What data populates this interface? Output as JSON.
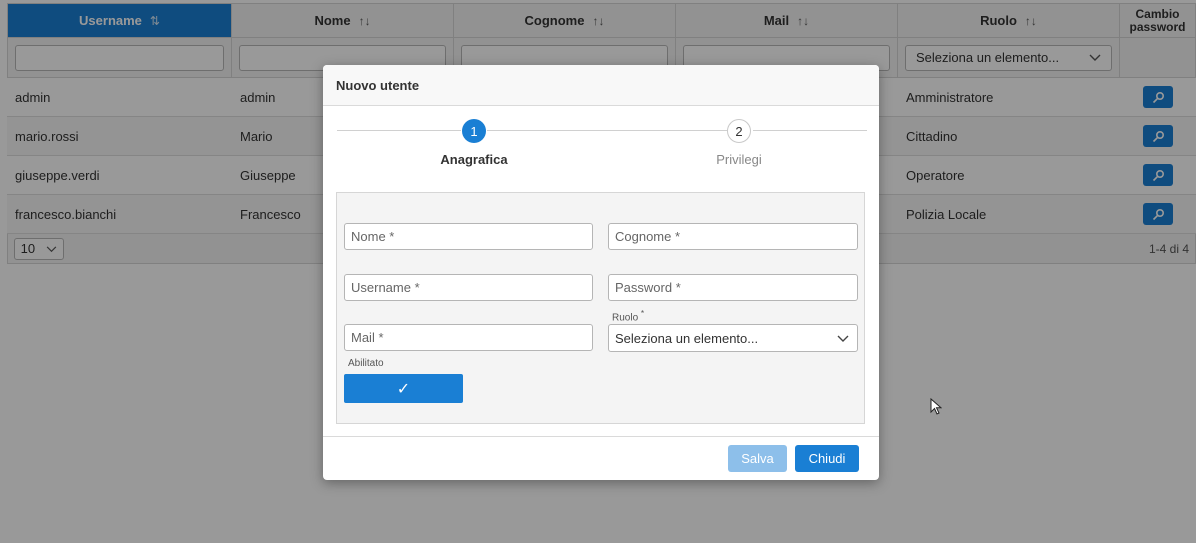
{
  "table": {
    "columns": [
      {
        "label": "Username",
        "sort": "⇅",
        "active": true
      },
      {
        "label": "Nome",
        "sort": "↑↓"
      },
      {
        "label": "Cognome",
        "sort": "↑↓"
      },
      {
        "label": "Mail",
        "sort": "↑↓"
      },
      {
        "label": "Ruolo",
        "sort": "↑↓"
      },
      {
        "label": "Cambio password"
      }
    ],
    "role_filter_placeholder": "Seleziona un elemento...",
    "rows": [
      {
        "username": "admin",
        "nome": "admin",
        "ruolo": "Amministratore"
      },
      {
        "username": "mario.rossi",
        "nome": "Mario",
        "ruolo": "Cittadino"
      },
      {
        "username": "giuseppe.verdi",
        "nome": "Giuseppe",
        "ruolo": "Operatore"
      },
      {
        "username": "francesco.bianchi",
        "nome": "Francesco",
        "ruolo": "Polizia Locale"
      }
    ],
    "page_size": "10",
    "count_label": "1-4 di 4"
  },
  "modal": {
    "title": "Nuovo utente",
    "steps": [
      {
        "number": "1",
        "label": "Anagrafica",
        "active": true
      },
      {
        "number": "2",
        "label": "Privilegi",
        "active": false
      }
    ],
    "fields": {
      "nome": "Nome *",
      "cognome": "Cognome *",
      "username": "Username *",
      "password": "Password *",
      "mail": "Mail *",
      "ruolo_label": "Ruolo",
      "ruolo_required": "*",
      "ruolo_placeholder": "Seleziona un elemento...",
      "abilitato_label": "Abilitato",
      "abilitato_check": "✓"
    },
    "buttons": {
      "save": "Salva",
      "close": "Chiudi"
    }
  },
  "colors": {
    "accent": "#1a7fd4",
    "disabled_accent": "#8dbfea"
  }
}
